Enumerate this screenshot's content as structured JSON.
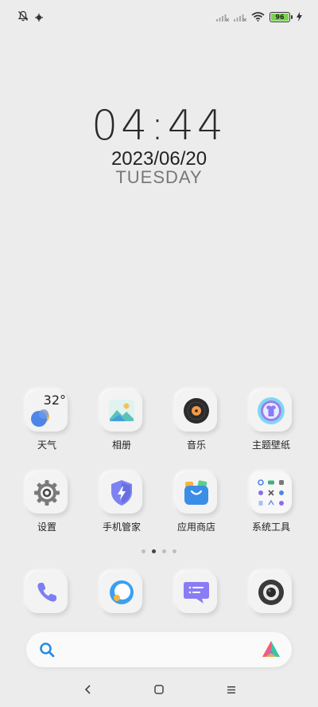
{
  "status": {
    "battery": "96",
    "icons": [
      "notifications-muted-icon",
      "wechat-icon",
      "signal-icon",
      "signal-icon",
      "wifi-icon",
      "battery-icon",
      "charging-icon"
    ]
  },
  "clock": {
    "time": "04:44",
    "date": "2023/06/20",
    "day": "TUESDAY"
  },
  "weather": {
    "temperature": "32°"
  },
  "apps_row1": [
    {
      "label": "天气",
      "icon": "weather-icon"
    },
    {
      "label": "相册",
      "icon": "gallery-icon"
    },
    {
      "label": "音乐",
      "icon": "music-icon"
    },
    {
      "label": "主题壁纸",
      "icon": "themes-icon"
    }
  ],
  "apps_row2": [
    {
      "label": "设置",
      "icon": "settings-icon"
    },
    {
      "label": "手机管家",
      "icon": "security-icon"
    },
    {
      "label": "应用商店",
      "icon": "app-store-icon"
    },
    {
      "label": "系统工具",
      "icon": "system-tools-folder-icon"
    }
  ],
  "page_indicator": {
    "pages": 4,
    "current": 2
  },
  "dock": [
    {
      "icon": "phone-icon"
    },
    {
      "icon": "browser-icon"
    },
    {
      "icon": "messages-icon"
    },
    {
      "icon": "camera-icon"
    }
  ],
  "colors": {
    "background": "#ececec",
    "accent_blue": "#3a8ee6",
    "battery_green": "#7bd34f"
  }
}
